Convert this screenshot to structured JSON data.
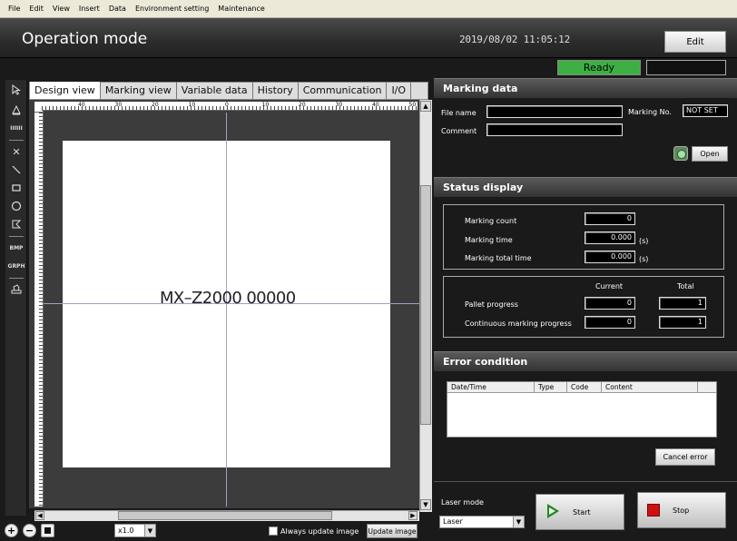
{
  "menu": [
    "File",
    "Edit",
    "View",
    "Insert",
    "Data",
    "Environment setting",
    "Maintenance"
  ],
  "header": {
    "title": "Operation mode",
    "datetime": "2019/08/02 11:05:12",
    "edit_label": "Edit",
    "status": "Ready",
    "status_color": "#3cb043"
  },
  "toolbar": {
    "icons": [
      "pointer-icon",
      "triangle-icon",
      "barcode-icon",
      "cross-icon",
      "line-icon",
      "rectangle-icon",
      "circle-icon",
      "polygon-icon",
      "bmp-icon",
      "graph-icon",
      "stamp-icon"
    ],
    "bmp_text": "BMP",
    "graph_text": "GRPH",
    "barcode_text": "IIIIII"
  },
  "tabs": [
    "Design view",
    "Marking view",
    "Variable data",
    "History",
    "Communication",
    "I/O"
  ],
  "canvas": {
    "text": "MX–Z2000 00000",
    "ruler_labels": [
      "40",
      "30",
      "20",
      "10",
      "0",
      "10",
      "20",
      "30",
      "40",
      "50"
    ]
  },
  "bottom": {
    "zoom": "x1.0",
    "always_update": "Always update image",
    "update_label": "Update image"
  },
  "marking_data": {
    "header": "Marking data",
    "file_name_label": "File name",
    "file_name": "",
    "comment_label": "Comment",
    "comment": "",
    "marking_no_label": "Marking No.",
    "marking_no": "NOT SET",
    "open_label": "Open"
  },
  "status_display": {
    "header": "Status display",
    "count_label": "Marking count",
    "count": "0",
    "time_label": "Marking time",
    "time": "0.000",
    "time_unit": "(s)",
    "total_label": "Marking total time",
    "total": "0.000",
    "total_unit": "(s)",
    "current_label": "Current",
    "total_col_label": "Total",
    "pallet_label": "Pallet progress",
    "pallet_current": "0",
    "pallet_total": "1",
    "continuous_label": "Continuous marking progress",
    "continuous_current": "0",
    "continuous_total": "1"
  },
  "error": {
    "header": "Error condition",
    "columns": [
      "Date/Time",
      "Type",
      "Code",
      "Content"
    ],
    "cancel_label": "Cancel error"
  },
  "laser": {
    "mode_label": "Laser mode",
    "mode": "Laser",
    "start_label": "Start",
    "stop_label": "Stop"
  }
}
